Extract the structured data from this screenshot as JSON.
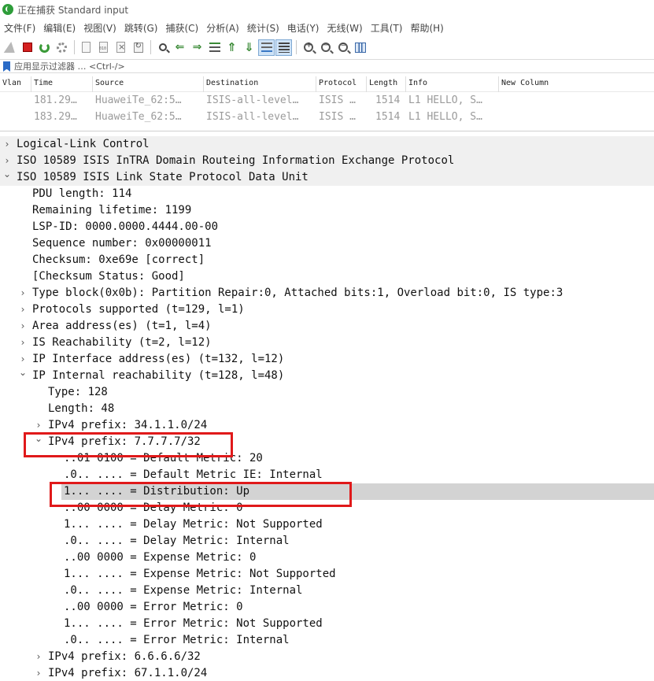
{
  "window": {
    "title": "正在捕获 Standard input"
  },
  "menu": [
    "文件(F)",
    "编辑(E)",
    "视图(V)",
    "跳转(G)",
    "捕获(C)",
    "分析(A)",
    "统计(S)",
    "电话(Y)",
    "无线(W)",
    "工具(T)",
    "帮助(H)"
  ],
  "toolbar": {
    "buttons": [
      {
        "name": "start-capture-icon",
        "pressed": false
      },
      {
        "name": "stop-capture-icon",
        "pressed": false
      },
      {
        "name": "restart-capture-icon",
        "pressed": false
      },
      {
        "name": "capture-options-icon",
        "pressed": false
      },
      {
        "name": "open-file-icon",
        "pressed": false
      },
      {
        "name": "save-file-icon",
        "pressed": false
      },
      {
        "name": "close-file-icon",
        "pressed": false
      },
      {
        "name": "reload-file-icon",
        "pressed": false
      },
      {
        "name": "find-packet-icon",
        "pressed": false
      },
      {
        "name": "go-back-icon",
        "pressed": false
      },
      {
        "name": "go-forward-icon",
        "pressed": false
      },
      {
        "name": "go-to-packet-icon",
        "pressed": false
      },
      {
        "name": "go-first-packet-icon",
        "pressed": false
      },
      {
        "name": "go-last-packet-icon",
        "pressed": false
      },
      {
        "name": "auto-scroll-icon",
        "pressed": true
      },
      {
        "name": "colorize-icon",
        "pressed": true
      },
      {
        "name": "zoom-in-icon",
        "pressed": false
      },
      {
        "name": "zoom-out-icon",
        "pressed": false
      },
      {
        "name": "normal-size-icon",
        "pressed": false
      },
      {
        "name": "resize-columns-icon",
        "pressed": false
      }
    ]
  },
  "filter": {
    "placeholder": "应用显示过滤器 … <Ctrl-/>"
  },
  "packet_list": {
    "columns": [
      "Vlan",
      "Time",
      "Source",
      "Destination",
      "Protocol",
      "Length",
      "Info",
      "New Column"
    ],
    "rows": [
      {
        "vlan": "",
        "time": "181.29…",
        "source": "HuaweiTe_62:5…",
        "destination": "ISIS-all-level…",
        "protocol": "ISIS …",
        "length": "1514",
        "info": "L1 HELLO, S…",
        "new_column": ""
      },
      {
        "vlan": "",
        "time": "183.29…",
        "source": "HuaweiTe_62:5…",
        "destination": "ISIS-all-level…",
        "protocol": "ISIS …",
        "length": "1514",
        "info": "L1 HELLO, S…",
        "new_column": ""
      }
    ]
  },
  "tree": [
    {
      "level": 0,
      "twisty": "collapsed",
      "text": "Logical-Link Control",
      "section": true
    },
    {
      "level": 0,
      "twisty": "collapsed",
      "text": "ISO 10589 ISIS InTRA Domain Routeing Information Exchange Protocol",
      "section": true
    },
    {
      "level": 0,
      "twisty": "expanded",
      "text": "ISO 10589 ISIS Link State Protocol Data Unit",
      "section": true
    },
    {
      "level": 1,
      "twisty": "none",
      "text": "PDU length: 114"
    },
    {
      "level": 1,
      "twisty": "none",
      "text": "Remaining lifetime: 1199"
    },
    {
      "level": 1,
      "twisty": "none",
      "text": "LSP-ID: 0000.0000.4444.00-00"
    },
    {
      "level": 1,
      "twisty": "none",
      "text": "Sequence number: 0x00000011"
    },
    {
      "level": 1,
      "twisty": "none",
      "text": "Checksum: 0xe69e [correct]"
    },
    {
      "level": 1,
      "twisty": "none",
      "text": "[Checksum Status: Good]"
    },
    {
      "level": 1,
      "twisty": "collapsed",
      "text": "Type block(0x0b): Partition Repair:0, Attached bits:1, Overload bit:0, IS type:3"
    },
    {
      "level": 1,
      "twisty": "collapsed",
      "text": "Protocols supported (t=129, l=1)"
    },
    {
      "level": 1,
      "twisty": "collapsed",
      "text": "Area address(es) (t=1, l=4)"
    },
    {
      "level": 1,
      "twisty": "collapsed",
      "text": "IS Reachability (t=2, l=12)"
    },
    {
      "level": 1,
      "twisty": "collapsed",
      "text": "IP Interface address(es) (t=132, l=12)"
    },
    {
      "level": 1,
      "twisty": "expanded",
      "text": "IP Internal reachability (t=128, l=48)"
    },
    {
      "level": 2,
      "twisty": "none",
      "text": "Type: 128"
    },
    {
      "level": 2,
      "twisty": "none",
      "text": "Length: 48"
    },
    {
      "level": 2,
      "twisty": "collapsed",
      "text": "IPv4 prefix: 34.1.1.0/24"
    },
    {
      "level": 2,
      "twisty": "expanded",
      "text": "IPv4 prefix: 7.7.7.7/32",
      "boxed": true
    },
    {
      "level": 3,
      "twisty": "none",
      "text": "..01 0100 = Default Metric: 20"
    },
    {
      "level": 3,
      "twisty": "none",
      "text": ".0.. .... = Default Metric IE: Internal"
    },
    {
      "level": 3,
      "twisty": "none",
      "text": "1... .... = Distribution: Up",
      "selected": true,
      "boxed": true
    },
    {
      "level": 3,
      "twisty": "none",
      "text": "..00 0000 = Delay Metric: 0"
    },
    {
      "level": 3,
      "twisty": "none",
      "text": "1... .... = Delay Metric: Not Supported"
    },
    {
      "level": 3,
      "twisty": "none",
      "text": ".0.. .... = Delay Metric: Internal"
    },
    {
      "level": 3,
      "twisty": "none",
      "text": "..00 0000 = Expense Metric: 0"
    },
    {
      "level": 3,
      "twisty": "none",
      "text": "1... .... = Expense Metric: Not Supported"
    },
    {
      "level": 3,
      "twisty": "none",
      "text": ".0.. .... = Expense Metric: Internal"
    },
    {
      "level": 3,
      "twisty": "none",
      "text": "..00 0000 = Error Metric: 0"
    },
    {
      "level": 3,
      "twisty": "none",
      "text": "1... .... = Error Metric: Not Supported"
    },
    {
      "level": 3,
      "twisty": "none",
      "text": ".0.. .... = Error Metric: Internal"
    },
    {
      "level": 2,
      "twisty": "collapsed",
      "text": "IPv4 prefix: 6.6.6.6/32"
    },
    {
      "level": 2,
      "twisty": "collapsed",
      "text": "IPv4 prefix: 67.1.1.0/24"
    }
  ],
  "colors": {
    "highlight_box": "#e0191a",
    "selected_row": "#d3d3d3",
    "section_row": "#f0f0f0",
    "dim_packet_text": "#9b9b9b"
  }
}
